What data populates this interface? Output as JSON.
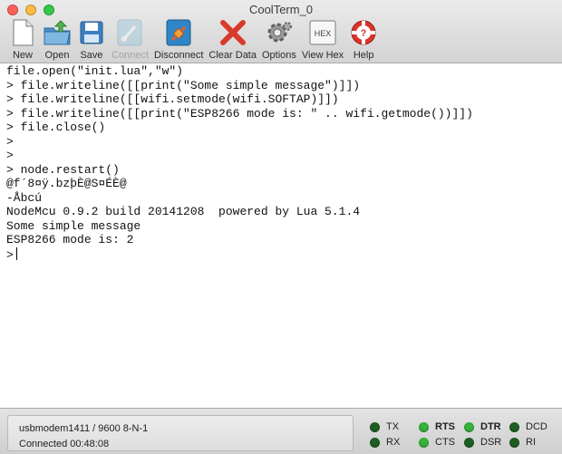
{
  "window": {
    "title": "CoolTerm_0"
  },
  "toolbar": {
    "items": [
      {
        "label": "New",
        "icon": "new-document-icon",
        "enabled": true
      },
      {
        "label": "Open",
        "icon": "open-folder-icon",
        "enabled": true
      },
      {
        "label": "Save",
        "icon": "save-floppy-icon",
        "enabled": true
      },
      {
        "label": "Connect",
        "icon": "connect-icon",
        "enabled": false
      },
      {
        "label": "Disconnect",
        "icon": "disconnect-icon",
        "enabled": true
      },
      {
        "label": "Clear Data",
        "icon": "clear-data-icon",
        "enabled": true
      },
      {
        "label": "Options",
        "icon": "options-gear-icon",
        "enabled": true
      },
      {
        "label": "View Hex",
        "icon": "hex-icon",
        "enabled": true,
        "icon_text": "HEX"
      },
      {
        "label": "Help",
        "icon": "help-lifebuoy-icon",
        "enabled": true
      }
    ]
  },
  "terminal": {
    "lines": [
      "file.open(\"init.lua\",\"w\")",
      "> file.writeline([[print(\"Some simple message\")]])",
      "> file.writeline([[wifi.setmode(wifi.SOFTAP)]])",
      "> file.writeline([[print(\"ESP8266 mode is: \" .. wifi.getmode())]])",
      "> file.close()",
      ">",
      ">",
      "> node.restart()",
      "@f´8¤ÿ.bzþÈ@S¤ÉÈ@",
      "-Åbcú",
      "NodeMcu 0.9.2 build 20141208  powered by Lua 5.1.4",
      "Some simple message",
      "ESP8266 mode is: 2"
    ],
    "prompt": ">"
  },
  "status": {
    "port_settings": "usbmodem1411 / 9600 8-N-1",
    "connection": "Connected 00:48:08",
    "colors": {
      "led_on": "#35b23a",
      "led_off": "#1f5e22"
    },
    "signals": [
      {
        "label": "TX",
        "state": "off"
      },
      {
        "label": "RX",
        "state": "off"
      },
      {
        "label": "RTS",
        "state": "on"
      },
      {
        "label": "CTS",
        "state": "on"
      },
      {
        "label": "DTR",
        "state": "on"
      },
      {
        "label": "DSR",
        "state": "off"
      },
      {
        "label": "DCD",
        "state": "off"
      },
      {
        "label": "RI",
        "state": "off"
      }
    ]
  }
}
